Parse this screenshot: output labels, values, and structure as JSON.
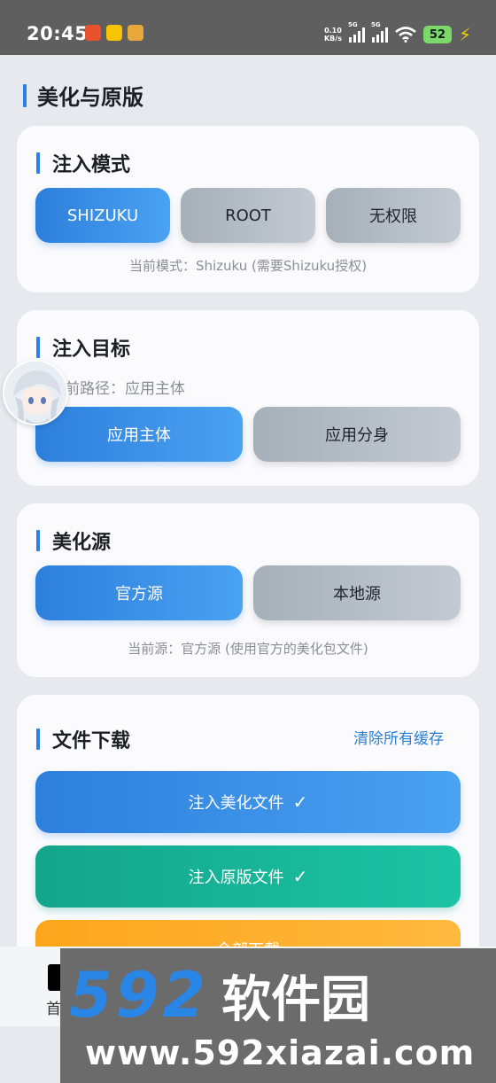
{
  "status_bar": {
    "time": "20:45",
    "net_speed_value": "0.10",
    "net_speed_unit": "KB/s",
    "sim1_label": "5G",
    "sim2_label": "5G",
    "battery": "52"
  },
  "page": {
    "section_title": "美化与原版"
  },
  "inject_mode": {
    "title": "注入模式",
    "options": [
      "SHIZUKU",
      "ROOT",
      "无权限"
    ],
    "selected": "SHIZUKU",
    "hint": "当前模式：Shizuku (需要Shizuku授权)"
  },
  "inject_target": {
    "title": "注入目标",
    "path_text": "前路径：应用主体",
    "options": [
      "应用主体",
      "应用分身"
    ],
    "selected": "应用主体"
  },
  "beautify_source": {
    "title": "美化源",
    "options": [
      "官方源",
      "本地源"
    ],
    "selected": "官方源",
    "hint": "当前源：官方源 (使用官方的美化包文件)"
  },
  "file_download": {
    "title": "文件下载",
    "clear_cache": "清除所有缓存",
    "inject_beautify": "注入美化文件",
    "inject_original": "注入原版文件",
    "check_mark": "✓",
    "download_all": "全部下载"
  },
  "bottom_nav": {
    "home_label": "首"
  },
  "watermark": {
    "number": "592",
    "name": "软件园",
    "url": "www.592xiazai.com"
  },
  "colors": {
    "accent": "#2f7fe0",
    "teal": "#14a58c",
    "orange": "#fca51c"
  }
}
